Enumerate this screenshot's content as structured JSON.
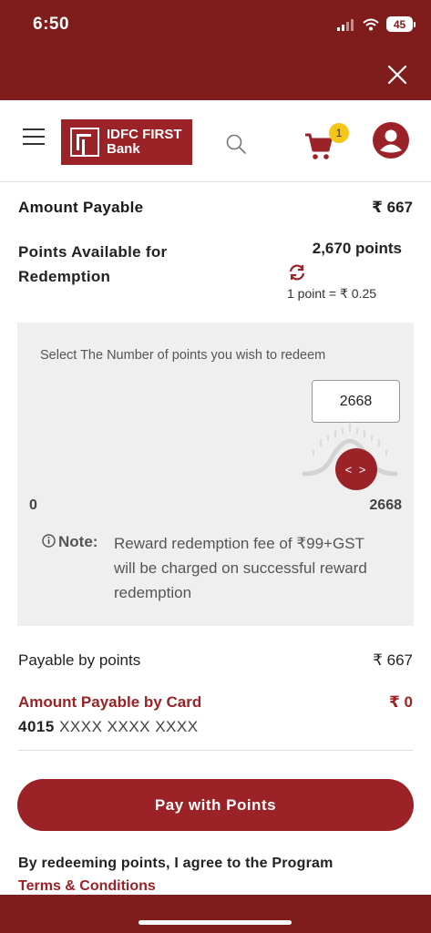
{
  "status_bar": {
    "time": "6:50",
    "battery": "45"
  },
  "header": {
    "logo_line1": "IDFC FIRST",
    "logo_line2": "Bank",
    "cart_count": "1"
  },
  "summary": {
    "amount_payable_label": "Amount Payable",
    "amount_payable_value": "₹ 667",
    "points_available_label": "Points Available for Redemption",
    "points_available_value": "2,670 points",
    "conversion_rate": "1 point = ₹ 0.25"
  },
  "slider": {
    "instruction": "Select The Number of points you wish to redeem",
    "input_value": "2668",
    "min_label": "0",
    "max_label": "2668",
    "thumb_label": "< >",
    "note_label": "Note:",
    "note_text": "Reward redemption fee of ₹99+GST will be charged on successful reward redemption"
  },
  "breakdown": {
    "payable_by_points_label": "Payable by points",
    "payable_by_points_value": "₹ 667",
    "amount_by_card_label": "Amount Payable by Card",
    "amount_by_card_value": "₹ 0",
    "card_prefix": "4015",
    "card_masked": "XXXX XXXX XXXX"
  },
  "actions": {
    "pay_button_label": "Pay with Points",
    "agree_text": "By redeeming points, I agree to the Program",
    "terms_link": "Terms & Conditions"
  },
  "colors": {
    "brand": "#9b2226",
    "chrome": "#7f1d1d",
    "badge": "#f5c518"
  }
}
